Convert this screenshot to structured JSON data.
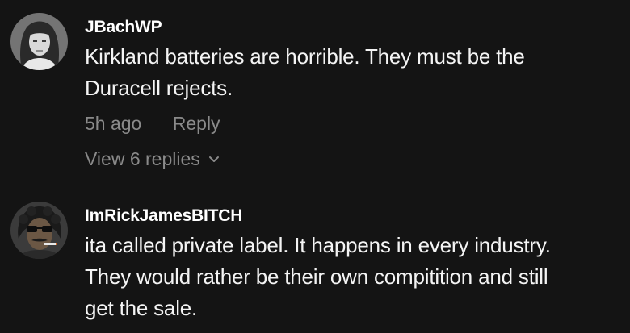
{
  "comments": [
    {
      "username": "JBachWP",
      "lines": [
        "Kirkland batteries are horrible. They must be the",
        "Duracell rejects."
      ],
      "time": "5h ago",
      "reply_label": "Reply",
      "view_replies_label": "View 6 replies",
      "avatar_icon": "user-avatar-woman-icon"
    },
    {
      "username": "ImRickJamesBITCH",
      "lines": [
        "ita called private label. It happens in every industry.",
        "They would rather be their own compitition and still",
        "get the sale."
      ],
      "avatar_icon": "user-avatar-man-sunglasses-icon"
    }
  ],
  "colors": {
    "background": "#141414",
    "primary_text": "#ffffff",
    "secondary_text": "#8a8a8a"
  }
}
